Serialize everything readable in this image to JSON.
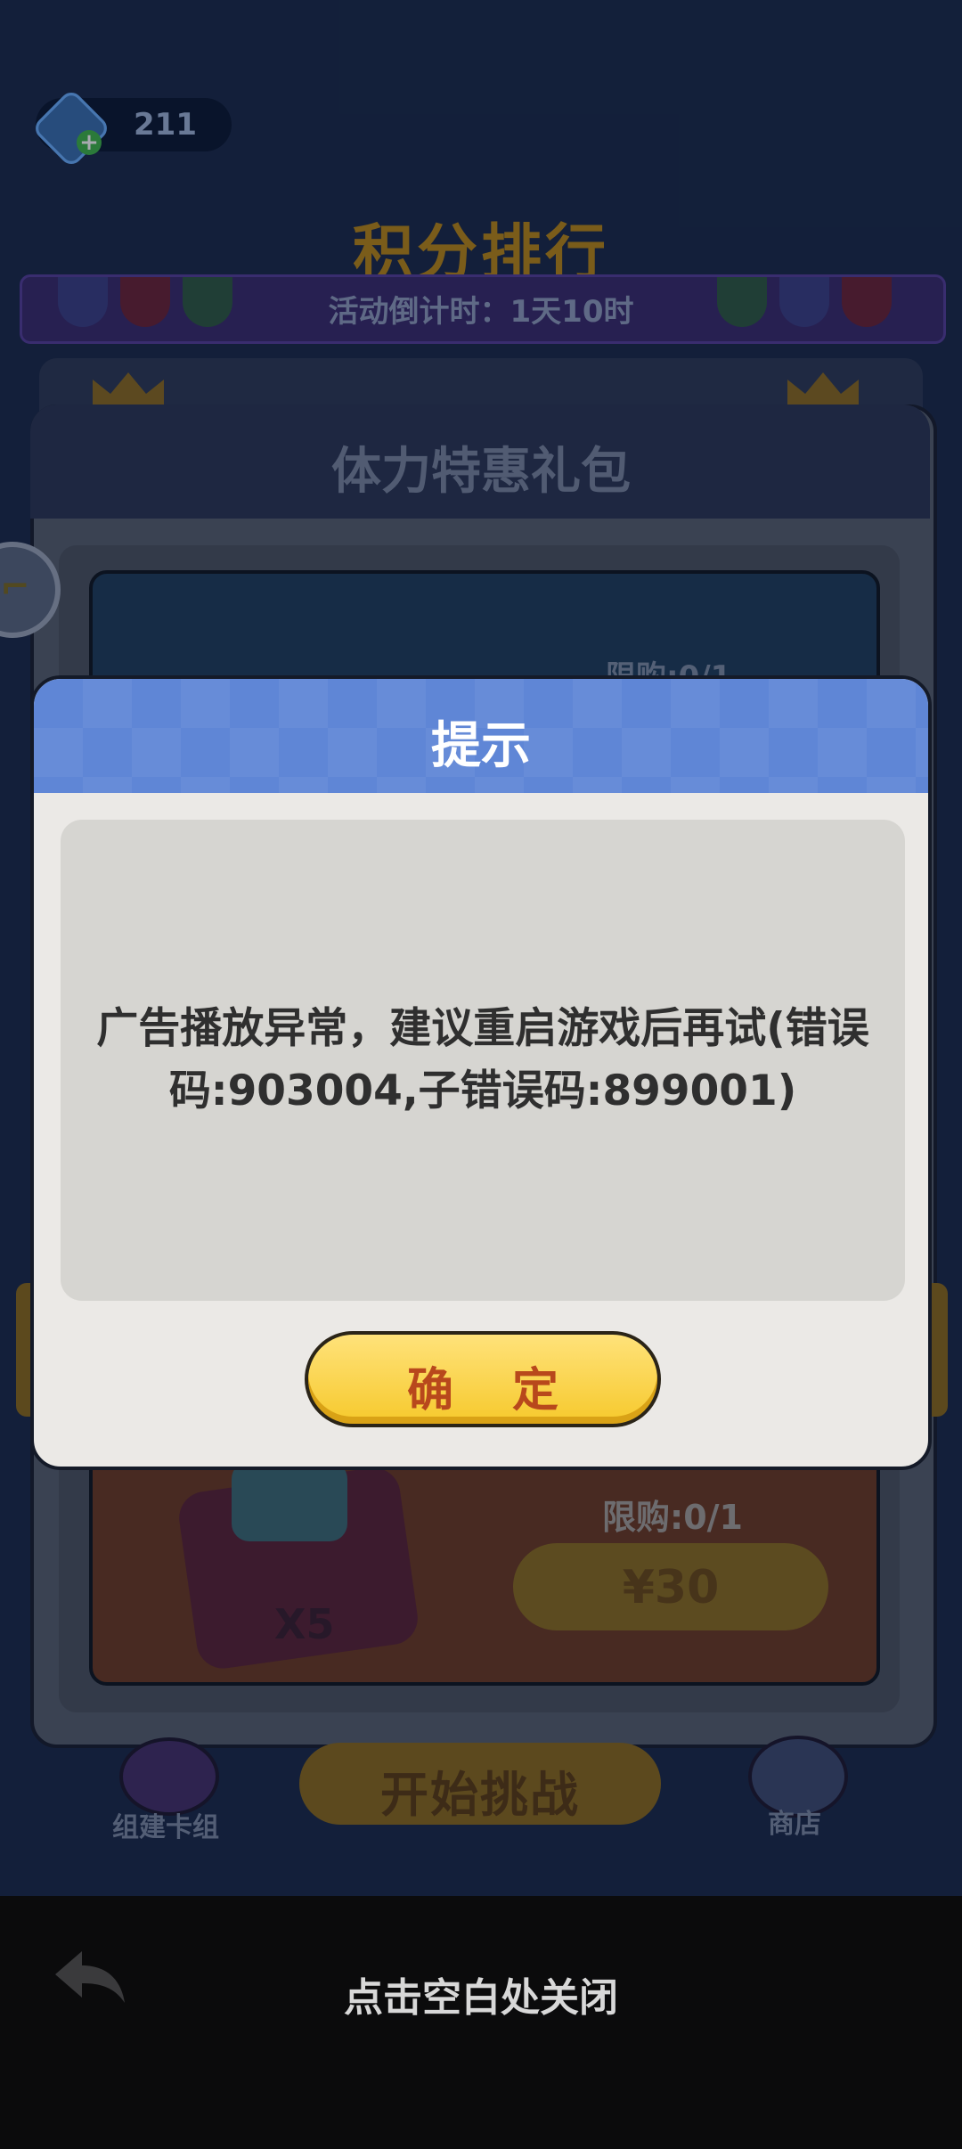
{
  "background": {
    "gem_count": "211",
    "rank_title": "积分排行",
    "countdown": "活动倒计时：1天10时",
    "pack_title": "体力特惠礼包",
    "pack_item_top": {
      "limit": "限购:0/1"
    },
    "pack_item_bottom": {
      "count": "X5",
      "limit": "限购:0/1",
      "price": "¥30"
    },
    "bottom_nav": {
      "deck_label": "组建卡组",
      "start_label": "开始挑战",
      "shop_label": "商店"
    }
  },
  "dialog": {
    "title": "提示",
    "message": "广告播放异常，建议重启游戏后再试(错误码:903004,子错误码:899001)",
    "confirm_label": "确 定"
  },
  "close_bar": {
    "hint": "点击空白处关闭",
    "back_icon": "back-arrow-icon"
  },
  "colors": {
    "dialog_header": "#5f86d6",
    "confirm_button": "#f6c92c",
    "confirm_text": "#b8481c",
    "close_bar": "#0b0b0c"
  }
}
